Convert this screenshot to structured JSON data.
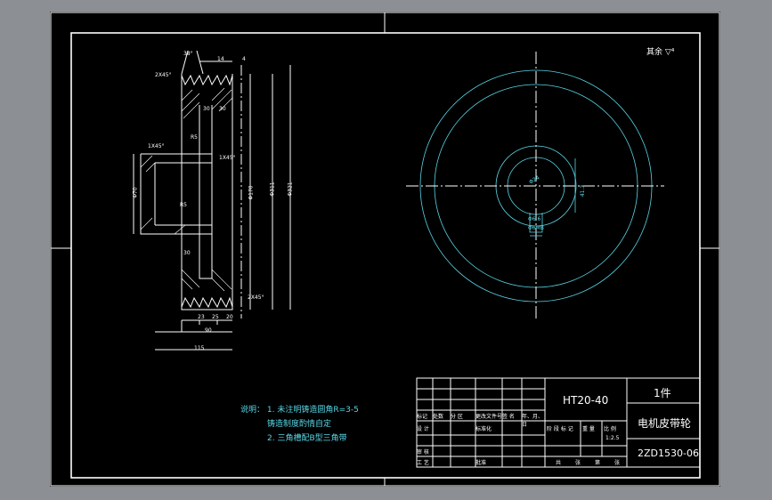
{
  "colors": {
    "background": "#000000",
    "frame": "#ffffff",
    "dimension": "#58d6e6",
    "outer": "#8c9094"
  },
  "roughness_note": "其余 ▽⁴",
  "notes": {
    "heading": "说明：",
    "line1": "1. 未注明铸造圆角R=3-5",
    "line2": "铸造制度酌情自定",
    "line3": "2. 三角槽配B型三角带"
  },
  "dims": {
    "angle_top": "38°",
    "top_w": "14",
    "top_r": "4",
    "chamfer_top": "2X45°",
    "chamfer_hub_upper": "1X45°",
    "chamfer_hub_mid": "1X45°",
    "chamfer_bottom": "2X45°",
    "d30a": "30",
    "d30b": "30",
    "d30c": "30",
    "r_small": "R5",
    "r_hub": "R5",
    "phi_bore": "Φ70",
    "phi_hub": "Φ170",
    "phi_mid": "Φ311",
    "phi_outer": "Φ321",
    "w23": "23",
    "w25": "25",
    "w20": "20",
    "w90": "90",
    "w115": "115",
    "bore_dia": "Φ24",
    "key_h": "41.3",
    "key_w": "Φ6.6",
    "key_label": "Φ6MB"
  },
  "title_block": {
    "material": "HT20-40",
    "quantity": "1件",
    "part_name": "电机皮带轮",
    "drawing_no": "2ZD1530-06",
    "scale": "1:2.5",
    "r1": [
      "标记",
      "处数",
      "分 区",
      "更改文件号",
      "签 名",
      "年、月、日"
    ],
    "r2": [
      "设 计",
      "",
      "",
      "标准化",
      "",
      ""
    ],
    "r3": [
      "审 核",
      "",
      "",
      "",
      "",
      ""
    ],
    "r4": [
      "工 艺",
      "",
      "",
      "批准",
      "",
      ""
    ],
    "stage_labels": [
      "阶 段 标 记",
      "重 量",
      "比 例"
    ],
    "footer_labels": [
      "共",
      "张",
      "第",
      "张"
    ]
  }
}
